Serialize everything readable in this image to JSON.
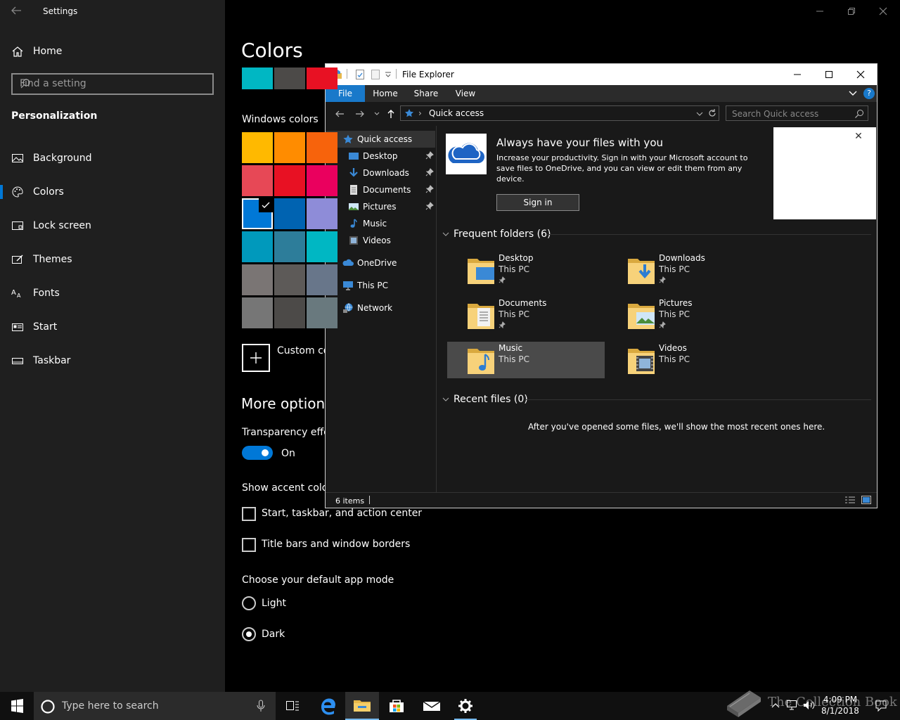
{
  "settings": {
    "app_title": "Settings",
    "home": "Home",
    "search_placeholder": "Find a setting",
    "section": "Personalization",
    "nav": [
      "Background",
      "Colors",
      "Lock screen",
      "Themes",
      "Fonts",
      "Start",
      "Taskbar"
    ],
    "page_title": "Colors",
    "windows_colors_label": "Windows colors",
    "custom_color": "Custom col",
    "more_options": "More options",
    "transparency_label": "Transparency effect",
    "transparency_state": "On",
    "show_accent_label": "Show accent color o",
    "accent_targets": [
      "Start, taskbar, and action center",
      "Title bars and window borders"
    ],
    "app_mode_label": "Choose your default app mode",
    "app_modes": [
      "Light",
      "Dark"
    ],
    "selected_mode": "Dark",
    "accent_color": "#0078d7",
    "recent_swatches": [
      "#00b7c3",
      "#4c4a48",
      "#e81123"
    ],
    "palette": [
      [
        "#ffb900",
        "#ff8c00",
        "#f7630c"
      ],
      [
        "#e74856",
        "#e81123",
        "#ea005e"
      ],
      [
        "#0078d7",
        "#0063b1",
        "#8e8cd8"
      ],
      [
        "#0099bc",
        "#2d7d9a",
        "#00b7c3"
      ],
      [
        "#7a7574",
        "#5d5a58",
        "#68768a"
      ],
      [
        "#767676",
        "#4c4a48",
        "#69797e"
      ]
    ]
  },
  "explorer": {
    "title": "File Explorer",
    "ribbon_tabs": [
      "File",
      "Home",
      "Share",
      "View"
    ],
    "address": "Quick access",
    "search_placeholder": "Search Quick access",
    "nav": {
      "quick_access": "Quick access",
      "pinned": [
        "Desktop",
        "Downloads",
        "Documents",
        "Pictures"
      ],
      "unpinned": [
        "Music",
        "Videos"
      ],
      "onedrive": "OneDrive",
      "this_pc": "This PC",
      "network": "Network"
    },
    "banner": {
      "heading": "Always have your files with you",
      "body": "Increase your productivity. Sign in with your Microsoft account to save files to OneDrive, and you can view or edit them from any device.",
      "button": "Sign in"
    },
    "frequent_header": "Frequent folders (6)",
    "folders": [
      {
        "name": "Desktop",
        "location": "This PC",
        "pinned": true
      },
      {
        "name": "Downloads",
        "location": "This PC",
        "pinned": true
      },
      {
        "name": "Documents",
        "location": "This PC",
        "pinned": true
      },
      {
        "name": "Pictures",
        "location": "This PC",
        "pinned": true
      },
      {
        "name": "Music",
        "location": "This PC",
        "pinned": false
      },
      {
        "name": "Videos",
        "location": "This PC",
        "pinned": false
      }
    ],
    "recent_header": "Recent files (0)",
    "recent_empty": "After you've opened some files, we'll show the most recent ones here.",
    "status": "6 items"
  },
  "taskbar": {
    "search_placeholder": "Type here to search",
    "time": "4:09 PM",
    "date": "8/1/2018",
    "watermark": "The Collection Book"
  }
}
